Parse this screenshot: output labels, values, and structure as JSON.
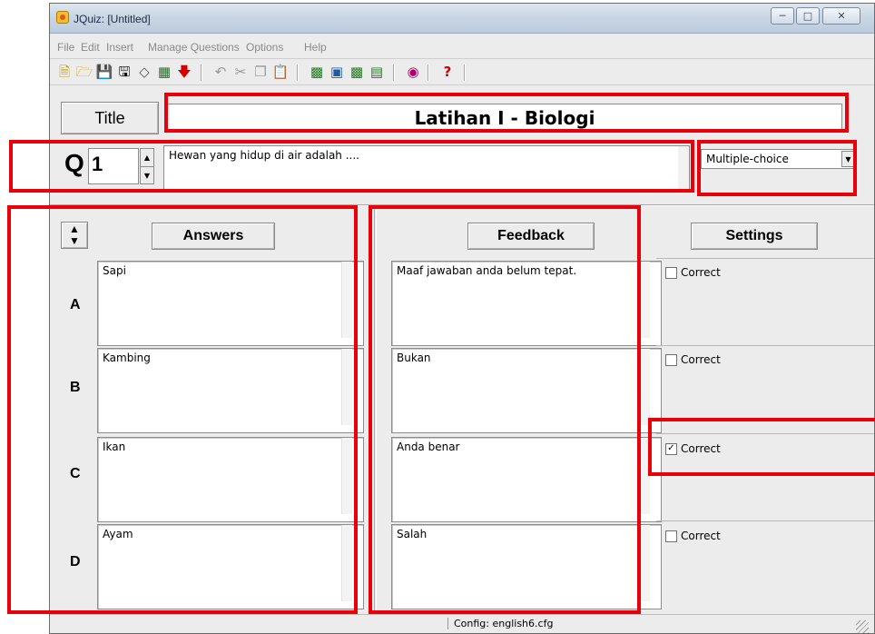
{
  "window": {
    "title": "JQuiz: [Untitled]"
  },
  "menu": [
    "File",
    "Edit",
    "Insert",
    "Manage Questions",
    "Options",
    "Help"
  ],
  "toolbar": {
    "icons": [
      "new-file-icon",
      "open-folder-icon",
      "save-icon",
      "save-as-icon",
      "eraser-icon",
      "web-page-icon",
      "down-arrow-icon",
      "undo-icon",
      "cut-icon",
      "copy-icon",
      "paste-icon",
      "export-icon",
      "export-alt-icon",
      "export-web-icon",
      "print-icon",
      "colors-icon",
      "help-icon"
    ]
  },
  "title_section": {
    "button_label": "Title",
    "value": "Latihan I - Biologi"
  },
  "question": {
    "label": "Q",
    "number": "1",
    "text": "Hewan yang hidup di air adalah ....",
    "type": "Multiple-choice"
  },
  "headers": {
    "answers": "Answers",
    "feedback": "Feedback",
    "settings": "Settings"
  },
  "rows": [
    {
      "letter": "A",
      "answer": "Sapi",
      "feedback": "Maaf jawaban anda belum tepat.",
      "correct_label": "Correct",
      "checked": false
    },
    {
      "letter": "B",
      "answer": "Kambing",
      "feedback": "Bukan",
      "correct_label": "Correct",
      "checked": false
    },
    {
      "letter": "C",
      "answer": "Ikan",
      "feedback": "Anda benar",
      "correct_label": "Correct",
      "checked": true
    },
    {
      "letter": "D",
      "answer": "Ayam",
      "feedback": "Salah",
      "correct_label": "Correct",
      "checked": false
    }
  ],
  "status": {
    "config": "Config: english6.cfg"
  },
  "colors": {
    "highlight": "#e8000b",
    "window_bg": "#ececec"
  }
}
